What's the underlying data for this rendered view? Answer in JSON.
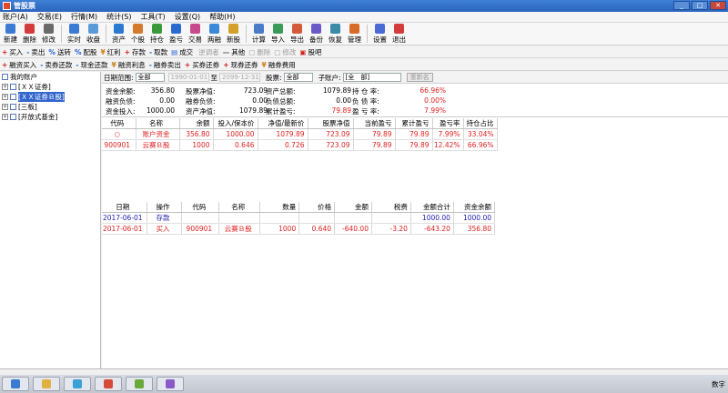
{
  "window": {
    "title": "管股票"
  },
  "menu": [
    "账户(A)",
    "交易(E)",
    "行情(M)",
    "统计(S)",
    "工具(T)",
    "设置(Q)",
    "帮助(H)"
  ],
  "toolbar": [
    {
      "label": "新建",
      "icon": "new-icon",
      "color": "#3b7bd4"
    },
    {
      "label": "删除",
      "icon": "delete-icon",
      "color": "#d43b3b"
    },
    {
      "label": "修改",
      "icon": "edit-icon",
      "color": "#6a6a6a"
    },
    {
      "label": "实时",
      "icon": "clock-icon",
      "color": "#3b7bd4"
    },
    {
      "label": "收盘",
      "icon": "close-market-icon",
      "color": "#5a9ad8"
    },
    {
      "label": "资产",
      "icon": "asset-icon",
      "color": "#2a7ad0"
    },
    {
      "label": "个股",
      "icon": "stock-icon",
      "color": "#d47a2a"
    },
    {
      "label": "持仓",
      "icon": "position-icon",
      "color": "#3a9a3a"
    },
    {
      "label": "盈亏",
      "icon": "profit-icon",
      "color": "#2a6ad0"
    },
    {
      "label": "交易",
      "icon": "trade-icon",
      "color": "#c84a8a"
    },
    {
      "label": "两融",
      "icon": "margin-icon",
      "color": "#3a8ad8"
    },
    {
      "label": "新股",
      "icon": "ipo-icon",
      "color": "#d4a02a"
    },
    {
      "label": "计算",
      "icon": "calculator-icon",
      "color": "#4a7ac8"
    },
    {
      "label": "导入",
      "icon": "import-icon",
      "color": "#3a9a5a"
    },
    {
      "label": "导出",
      "icon": "export-icon",
      "color": "#d45a3a"
    },
    {
      "label": "备份",
      "icon": "backup-icon",
      "color": "#6a5ac8"
    },
    {
      "label": "恢复",
      "icon": "restore-icon",
      "color": "#3a8aa8"
    },
    {
      "label": "管理",
      "icon": "manage-icon",
      "color": "#d86a2a"
    },
    {
      "label": "设置",
      "icon": "settings-icon",
      "color": "#4a6ad8"
    },
    {
      "label": "退出",
      "icon": "exit-icon",
      "color": "#d43b3b"
    }
  ],
  "actions_row1": [
    {
      "sym": "+",
      "label": "买入",
      "color": "#d02020",
      "disabled": false
    },
    {
      "sym": "-",
      "label": "卖出",
      "color": "#2060d0",
      "disabled": false
    },
    {
      "sym": "%",
      "label": "送转",
      "color": "#2060d0",
      "disabled": false
    },
    {
      "sym": "%",
      "label": "配股",
      "color": "#2060d0",
      "disabled": false
    },
    {
      "sym": "¥",
      "label": "红利",
      "color": "#d08020",
      "disabled": false
    },
    {
      "sym": "+",
      "label": "存款",
      "color": "#d02020",
      "disabled": false
    },
    {
      "sym": "-",
      "label": "取款",
      "color": "#2060d0",
      "disabled": false
    },
    {
      "sym": "▤",
      "label": "成交",
      "color": "#2060d0",
      "disabled": false
    },
    {
      "sym": "",
      "label": "逆调者",
      "color": "#999999",
      "disabled": true
    },
    {
      "sym": "—",
      "label": "其他",
      "color": "#606060",
      "disabled": false
    },
    {
      "sym": "▢",
      "label": "删除",
      "color": "#999999",
      "disabled": true
    },
    {
      "sym": "▢",
      "label": "修改",
      "color": "#999999",
      "disabled": true
    },
    {
      "sym": "▣",
      "label": "股吧",
      "color": "#d02020",
      "disabled": false
    }
  ],
  "actions_row2": [
    {
      "sym": "+",
      "label": "融资买入",
      "color": "#d02020"
    },
    {
      "sym": "-",
      "label": "卖券还款",
      "color": "#2060d0"
    },
    {
      "sym": "-",
      "label": "现金还款",
      "color": "#2060d0"
    },
    {
      "sym": "¥",
      "label": "融资利息",
      "color": "#d08020"
    },
    {
      "sym": "-",
      "label": "融券卖出",
      "color": "#2060d0"
    },
    {
      "sym": "+",
      "label": "买券还券",
      "color": "#d02020"
    },
    {
      "sym": "+",
      "label": "现券还券",
      "color": "#d02020"
    },
    {
      "sym": "¥",
      "label": "融券费用",
      "color": "#d08020"
    }
  ],
  "tree": {
    "root": "我的账户",
    "items": [
      {
        "label": "[ＸＸ证券]",
        "selected": false
      },
      {
        "label": "[ＸＸ证券Ｂ股]",
        "selected": true
      },
      {
        "label": "[三板]",
        "selected": false
      },
      {
        "label": "[开放式基金]",
        "selected": false
      }
    ]
  },
  "filter": {
    "date_range_label": "日期范围:",
    "date_range_value": "全部",
    "date_from": "1990-01-01",
    "to_label": "至",
    "date_to": "2099-12-31",
    "stock_label": "股票:",
    "stock_value": "全部",
    "subaccount_label": "子账户:",
    "subaccount_value": "[全　部]",
    "recalc_label": "重新名"
  },
  "summary": [
    {
      "label": "资金余额:",
      "value": "356.80"
    },
    {
      "label": "股票净值:",
      "value": "723.09"
    },
    {
      "label": "资产总额:",
      "value": "1079.89"
    },
    {
      "label": "持 仓 率:",
      "value": "66.96%"
    },
    {
      "label": "融资负债:",
      "value": "0.00"
    },
    {
      "label": "融券负债:",
      "value": "0.00"
    },
    {
      "label": "负债总额:",
      "value": "0.00"
    },
    {
      "label": "负 债 率:",
      "value": "0.00%"
    },
    {
      "label": "资金投入:",
      "value": "1000.00"
    },
    {
      "label": "资产净值:",
      "value": "1079.89"
    },
    {
      "label": "累计盈亏:",
      "value": "79.89"
    },
    {
      "label": "盈 亏 率:",
      "value": "7.99%"
    }
  ],
  "holdings": {
    "columns": [
      "代码",
      "名称",
      "余额",
      "投入/保本价",
      "净值/最新价",
      "股票净值",
      "当前盈亏",
      "累计盈亏",
      "盈亏率",
      "持仓占比"
    ],
    "rows": [
      [
        "○",
        "账户资金",
        "356.80",
        "1000.00",
        "1079.89",
        "723.09",
        "79.89",
        "79.89",
        "7.99%",
        "33.04%"
      ],
      [
        "900901",
        "云赛Ｂ股",
        "1000",
        "0.646",
        "0.726",
        "723.09",
        "79.89",
        "79.89",
        "12.42%",
        "66.96%"
      ]
    ]
  },
  "transactions": {
    "columns": [
      "日期",
      "操作",
      "代码",
      "名称",
      "数量",
      "价格",
      "金额",
      "税费",
      "金额合计",
      "资金余额"
    ],
    "rows": [
      [
        "2017-06-01",
        "存款",
        "",
        "",
        "",
        "",
        "",
        "",
        "1000.00",
        "1000.00"
      ],
      [
        "2017-06-01",
        "买入",
        "900901",
        "云赛Ｂ股",
        "1000",
        "0.640",
        "-640.00",
        "-3.20",
        "-643.20",
        "356.80"
      ]
    ]
  },
  "status": {
    "right_text": "数字"
  }
}
